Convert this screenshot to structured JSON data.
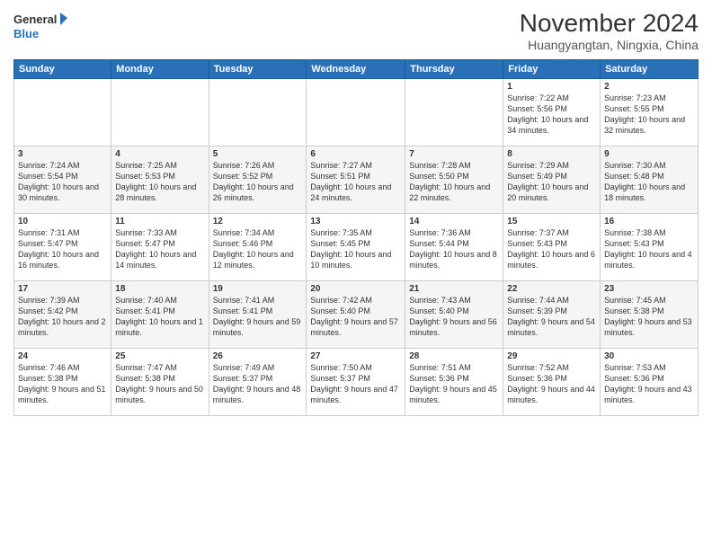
{
  "logo": {
    "line1": "General",
    "line2": "Blue"
  },
  "title": "November 2024",
  "location": "Huangyangtan, Ningxia, China",
  "days_of_week": [
    "Sunday",
    "Monday",
    "Tuesday",
    "Wednesday",
    "Thursday",
    "Friday",
    "Saturday"
  ],
  "weeks": [
    [
      {
        "day": "",
        "info": ""
      },
      {
        "day": "",
        "info": ""
      },
      {
        "day": "",
        "info": ""
      },
      {
        "day": "",
        "info": ""
      },
      {
        "day": "",
        "info": ""
      },
      {
        "day": "1",
        "info": "Sunrise: 7:22 AM\nSunset: 5:56 PM\nDaylight: 10 hours and 34 minutes."
      },
      {
        "day": "2",
        "info": "Sunrise: 7:23 AM\nSunset: 5:55 PM\nDaylight: 10 hours and 32 minutes."
      }
    ],
    [
      {
        "day": "3",
        "info": "Sunrise: 7:24 AM\nSunset: 5:54 PM\nDaylight: 10 hours and 30 minutes."
      },
      {
        "day": "4",
        "info": "Sunrise: 7:25 AM\nSunset: 5:53 PM\nDaylight: 10 hours and 28 minutes."
      },
      {
        "day": "5",
        "info": "Sunrise: 7:26 AM\nSunset: 5:52 PM\nDaylight: 10 hours and 26 minutes."
      },
      {
        "day": "6",
        "info": "Sunrise: 7:27 AM\nSunset: 5:51 PM\nDaylight: 10 hours and 24 minutes."
      },
      {
        "day": "7",
        "info": "Sunrise: 7:28 AM\nSunset: 5:50 PM\nDaylight: 10 hours and 22 minutes."
      },
      {
        "day": "8",
        "info": "Sunrise: 7:29 AM\nSunset: 5:49 PM\nDaylight: 10 hours and 20 minutes."
      },
      {
        "day": "9",
        "info": "Sunrise: 7:30 AM\nSunset: 5:48 PM\nDaylight: 10 hours and 18 minutes."
      }
    ],
    [
      {
        "day": "10",
        "info": "Sunrise: 7:31 AM\nSunset: 5:47 PM\nDaylight: 10 hours and 16 minutes."
      },
      {
        "day": "11",
        "info": "Sunrise: 7:33 AM\nSunset: 5:47 PM\nDaylight: 10 hours and 14 minutes."
      },
      {
        "day": "12",
        "info": "Sunrise: 7:34 AM\nSunset: 5:46 PM\nDaylight: 10 hours and 12 minutes."
      },
      {
        "day": "13",
        "info": "Sunrise: 7:35 AM\nSunset: 5:45 PM\nDaylight: 10 hours and 10 minutes."
      },
      {
        "day": "14",
        "info": "Sunrise: 7:36 AM\nSunset: 5:44 PM\nDaylight: 10 hours and 8 minutes."
      },
      {
        "day": "15",
        "info": "Sunrise: 7:37 AM\nSunset: 5:43 PM\nDaylight: 10 hours and 6 minutes."
      },
      {
        "day": "16",
        "info": "Sunrise: 7:38 AM\nSunset: 5:43 PM\nDaylight: 10 hours and 4 minutes."
      }
    ],
    [
      {
        "day": "17",
        "info": "Sunrise: 7:39 AM\nSunset: 5:42 PM\nDaylight: 10 hours and 2 minutes."
      },
      {
        "day": "18",
        "info": "Sunrise: 7:40 AM\nSunset: 5:41 PM\nDaylight: 10 hours and 1 minute."
      },
      {
        "day": "19",
        "info": "Sunrise: 7:41 AM\nSunset: 5:41 PM\nDaylight: 9 hours and 59 minutes."
      },
      {
        "day": "20",
        "info": "Sunrise: 7:42 AM\nSunset: 5:40 PM\nDaylight: 9 hours and 57 minutes."
      },
      {
        "day": "21",
        "info": "Sunrise: 7:43 AM\nSunset: 5:40 PM\nDaylight: 9 hours and 56 minutes."
      },
      {
        "day": "22",
        "info": "Sunrise: 7:44 AM\nSunset: 5:39 PM\nDaylight: 9 hours and 54 minutes."
      },
      {
        "day": "23",
        "info": "Sunrise: 7:45 AM\nSunset: 5:38 PM\nDaylight: 9 hours and 53 minutes."
      }
    ],
    [
      {
        "day": "24",
        "info": "Sunrise: 7:46 AM\nSunset: 5:38 PM\nDaylight: 9 hours and 51 minutes."
      },
      {
        "day": "25",
        "info": "Sunrise: 7:47 AM\nSunset: 5:38 PM\nDaylight: 9 hours and 50 minutes."
      },
      {
        "day": "26",
        "info": "Sunrise: 7:49 AM\nSunset: 5:37 PM\nDaylight: 9 hours and 48 minutes."
      },
      {
        "day": "27",
        "info": "Sunrise: 7:50 AM\nSunset: 5:37 PM\nDaylight: 9 hours and 47 minutes."
      },
      {
        "day": "28",
        "info": "Sunrise: 7:51 AM\nSunset: 5:36 PM\nDaylight: 9 hours and 45 minutes."
      },
      {
        "day": "29",
        "info": "Sunrise: 7:52 AM\nSunset: 5:36 PM\nDaylight: 9 hours and 44 minutes."
      },
      {
        "day": "30",
        "info": "Sunrise: 7:53 AM\nSunset: 5:36 PM\nDaylight: 9 hours and 43 minutes."
      }
    ]
  ]
}
